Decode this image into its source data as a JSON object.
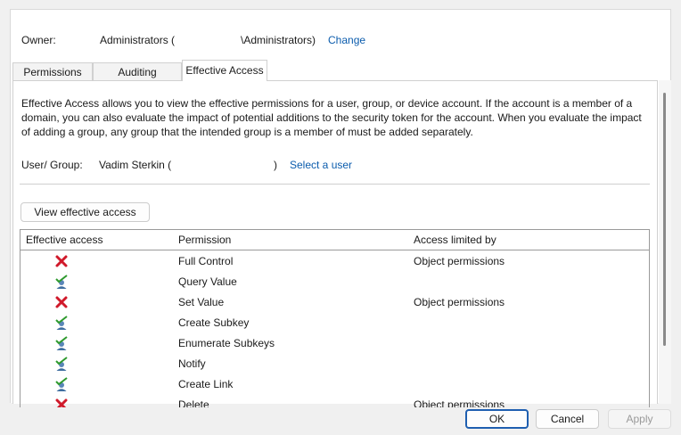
{
  "owner": {
    "label": "Owner:",
    "value_prefix": "Administrators (",
    "value_suffix": "\\Administrators)",
    "change_link": "Change"
  },
  "tabs": [
    {
      "label": "Permissions",
      "active": false
    },
    {
      "label": "Auditing",
      "active": false
    },
    {
      "label": "Effective Access",
      "active": true
    }
  ],
  "effective_access": {
    "description": "Effective Access allows you to view the effective permissions for a user, group, or device account. If the account is a member of a domain, you can also evaluate the impact of potential additions to the security token for the account. When you evaluate the impact of adding a group, any group that the intended group is a member of must be added separately.",
    "user_group_label": "User/ Group:",
    "user_group_value_prefix": "Vadim Sterkin (",
    "user_group_value_suffix": ")",
    "select_user_link": "Select a user",
    "view_button": "View effective access"
  },
  "table": {
    "columns": [
      "Effective access",
      "Permission",
      "Access limited by"
    ],
    "rows": [
      {
        "access": "denied",
        "icon": "red-x-icon",
        "permission": "Full Control",
        "limited_by": "Object permissions"
      },
      {
        "access": "allowed",
        "icon": "user-check-icon",
        "permission": "Query Value",
        "limited_by": ""
      },
      {
        "access": "denied",
        "icon": "red-x-icon",
        "permission": "Set Value",
        "limited_by": "Object permissions"
      },
      {
        "access": "allowed",
        "icon": "user-check-icon",
        "permission": "Create Subkey",
        "limited_by": ""
      },
      {
        "access": "allowed",
        "icon": "user-check-icon",
        "permission": "Enumerate Subkeys",
        "limited_by": ""
      },
      {
        "access": "allowed",
        "icon": "user-check-icon",
        "permission": "Notify",
        "limited_by": ""
      },
      {
        "access": "allowed",
        "icon": "user-check-icon",
        "permission": "Create Link",
        "limited_by": ""
      },
      {
        "access": "denied",
        "icon": "red-x-icon",
        "permission": "Delete",
        "limited_by": "Object permissions"
      }
    ]
  },
  "footer": {
    "ok": "OK",
    "cancel": "Cancel",
    "apply": "Apply",
    "apply_enabled": false
  },
  "colors": {
    "link": "#0b5cad",
    "deny": "#d0192a",
    "allow_check": "#2e9a2e",
    "default_button_border": "#1f5fb0"
  }
}
